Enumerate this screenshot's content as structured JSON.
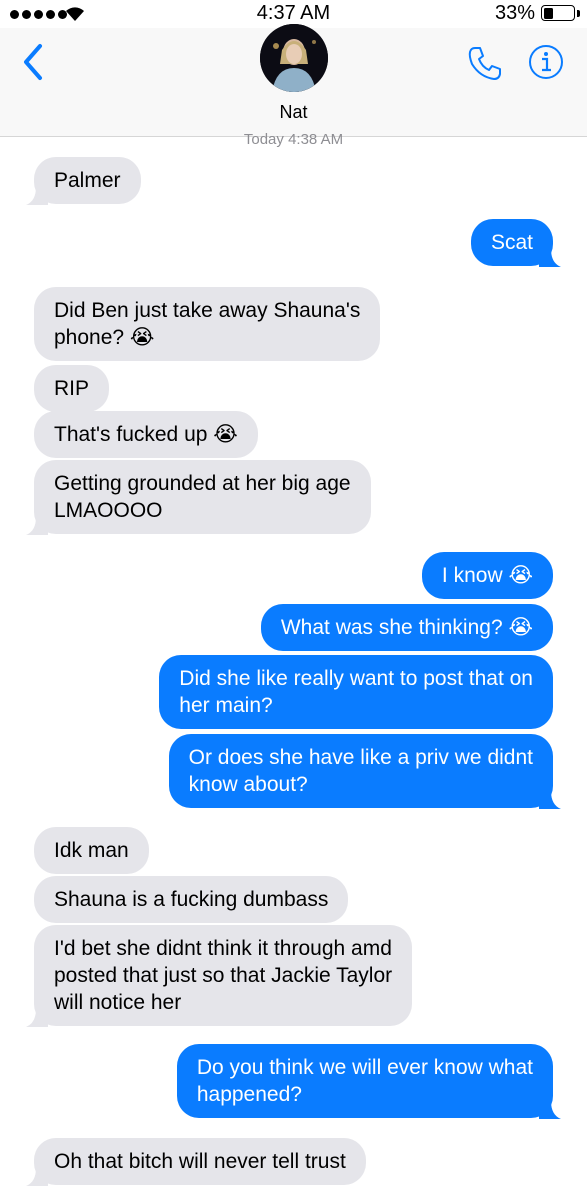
{
  "status_bar": {
    "time": "4:37 AM",
    "battery": "33%",
    "battery_level": 0.33
  },
  "header": {
    "contact_name": "Nat"
  },
  "thread": {
    "timestamp": "Today 4:38 AM",
    "messages": [
      {
        "side": "in",
        "text": "Palmer"
      },
      {
        "side": "out",
        "text": "Scat"
      },
      {
        "side": "in",
        "text": "Did Ben just take away Shauna's\nphone? 😭"
      },
      {
        "side": "in",
        "text": "RIP"
      },
      {
        "side": "in",
        "text": "That's fucked up 😭"
      },
      {
        "side": "in",
        "text": "Getting grounded at her big age\nLMAOOOO"
      },
      {
        "side": "out",
        "text": "I know 😭"
      },
      {
        "side": "out",
        "text": "What was she thinking? 😭"
      },
      {
        "side": "out",
        "text": "Did she like really want to post that on\nher main?"
      },
      {
        "side": "out",
        "text": "Or does she have like a priv we didnt\nknow about?"
      },
      {
        "side": "in",
        "text": "Idk man"
      },
      {
        "side": "in",
        "text": "Shauna is a fucking dumbass"
      },
      {
        "side": "in",
        "text": "I'd bet she didnt think it through amd\nposted that just so that Jackie Taylor\nwill notice her"
      },
      {
        "side": "out",
        "text": "Do you think we will ever know what\nhappened?"
      },
      {
        "side": "in",
        "text": "Oh that bitch will never tell trust"
      }
    ]
  },
  "colors": {
    "incoming": "#e5e5ea",
    "outgoing": "#0a7cff",
    "accent": "#0a7cff"
  },
  "icons": {
    "back": "chevron-left-icon",
    "call": "phone-icon",
    "details": "info-icon"
  }
}
